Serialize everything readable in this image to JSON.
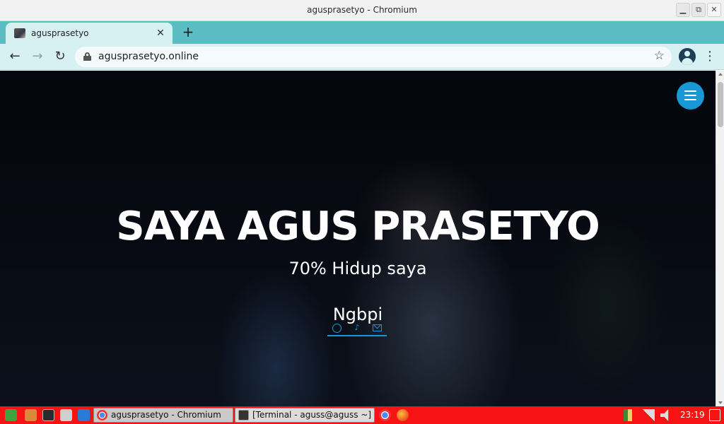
{
  "window": {
    "title": "agusprasetyo - Chromium",
    "minimize": "▁",
    "restore": "⧉",
    "close": "✕"
  },
  "tabs": [
    {
      "title": "agusprasetyo",
      "close": "✕"
    }
  ],
  "new_tab": "+",
  "toolbar": {
    "back": "←",
    "forward": "→",
    "reload": "↻",
    "url": "agusprasetyo.online",
    "bookmark": "☆",
    "menu": "⋮"
  },
  "hero": {
    "title": "SAYA AGUS PRASETYO",
    "subtitle": "70% Hidup saya",
    "typed": "Ngbpi",
    "social_icons": [
      "whatsapp-icon",
      "tiktok-icon",
      "mail-icon"
    ],
    "accent_color": "#1899d6"
  },
  "taskbar": {
    "windows": [
      {
        "label": "agusprasetyo - Chromium",
        "active": true
      },
      {
        "label": "[Terminal - aguss@aguss ~]",
        "active": false
      }
    ],
    "clock": "23:19",
    "color": "#f51313"
  }
}
